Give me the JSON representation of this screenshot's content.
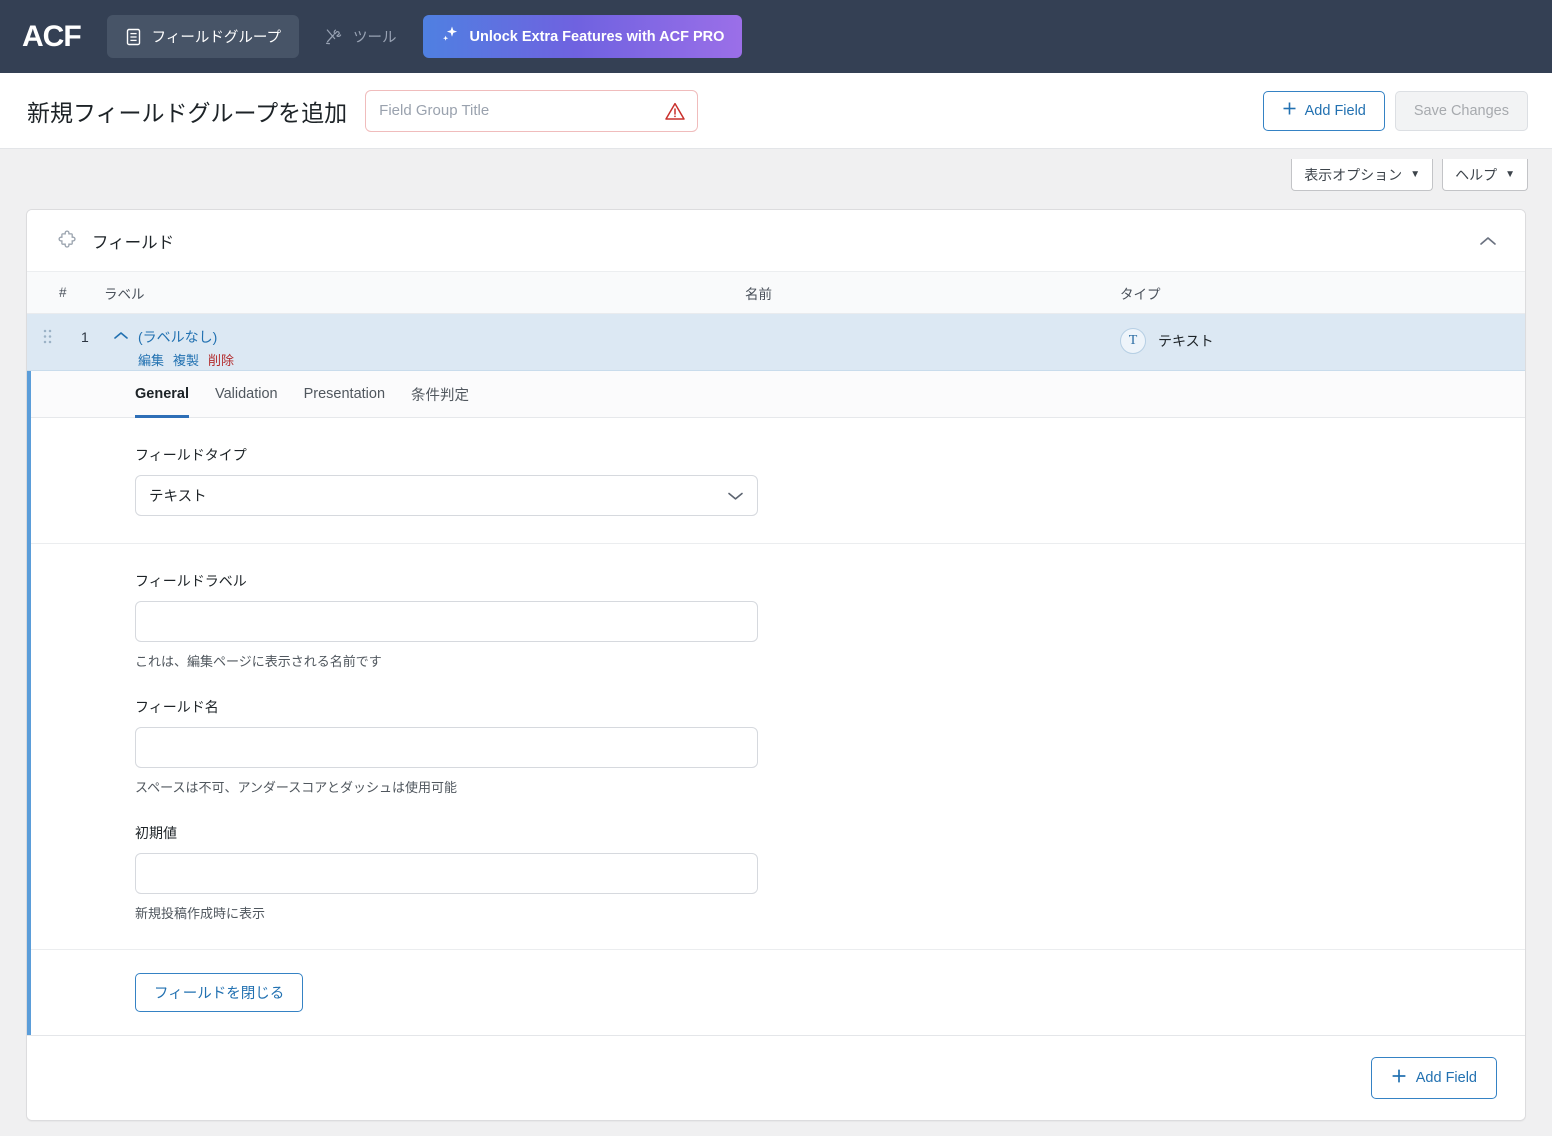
{
  "topbar": {
    "logo": "ACF",
    "nav": [
      {
        "label": "フィールドグループ",
        "icon": "document-icon",
        "active": true
      },
      {
        "label": "ツール",
        "icon": "tools-icon",
        "active": false
      }
    ],
    "pro_button": {
      "label": "Unlock Extra Features with ACF PRO",
      "icon": "sparkle-icon"
    }
  },
  "header": {
    "title": "新規フィールドグループを追加",
    "title_input_value": "",
    "title_input_placeholder": "Field Group Title",
    "warning_icon": "warning-triangle-icon",
    "add_field_label": "Add Field",
    "save_label": "Save Changes"
  },
  "screen_meta": {
    "display_options": "表示オプション",
    "help": "ヘルプ",
    "caret": "▼"
  },
  "panel": {
    "heading": "フィールド",
    "heading_icon": "puzzle-piece-icon",
    "collapse_icon": "chevron-up-icon",
    "columns": {
      "order": "#",
      "label": "ラベル",
      "name": "名前",
      "type": "タイプ"
    },
    "rows": [
      {
        "order": "1",
        "toggle_icon": "chevron-up-icon",
        "label": "(ラベルなし)",
        "name": "",
        "type": "テキスト",
        "type_glyph": "T",
        "actions": {
          "edit": "編集",
          "duplicate": "複製",
          "delete": "削除"
        }
      }
    ],
    "add_field_label": "Add Field"
  },
  "editor": {
    "tabs": [
      {
        "label": "General",
        "active": true
      },
      {
        "label": "Validation",
        "active": false
      },
      {
        "label": "Presentation",
        "active": false
      },
      {
        "label": "条件判定",
        "active": false
      }
    ],
    "field_type": {
      "label": "フィールドタイプ",
      "value": "テキスト",
      "chevron": "chevron-down-icon"
    },
    "field_label": {
      "label": "フィールドラベル",
      "value": "",
      "hint": "これは、編集ページに表示される名前です"
    },
    "field_name": {
      "label": "フィールド名",
      "value": "",
      "hint": "スペースは不可、アンダースコアとダッシュは使用可能"
    },
    "default_value": {
      "label": "初期値",
      "value": "",
      "hint": "新規投稿作成時に表示"
    },
    "close_field_label": "フィールドを閉じる"
  },
  "colors": {
    "topbar_bg": "#344054",
    "accent_blue": "#2271b1",
    "row_highlight": "#dce8f3",
    "left_accent": "#5b9dd9",
    "danger": "#b32d2e",
    "pro_gradient_from": "#4f80e1",
    "pro_gradient_to": "#9b6fe8"
  }
}
